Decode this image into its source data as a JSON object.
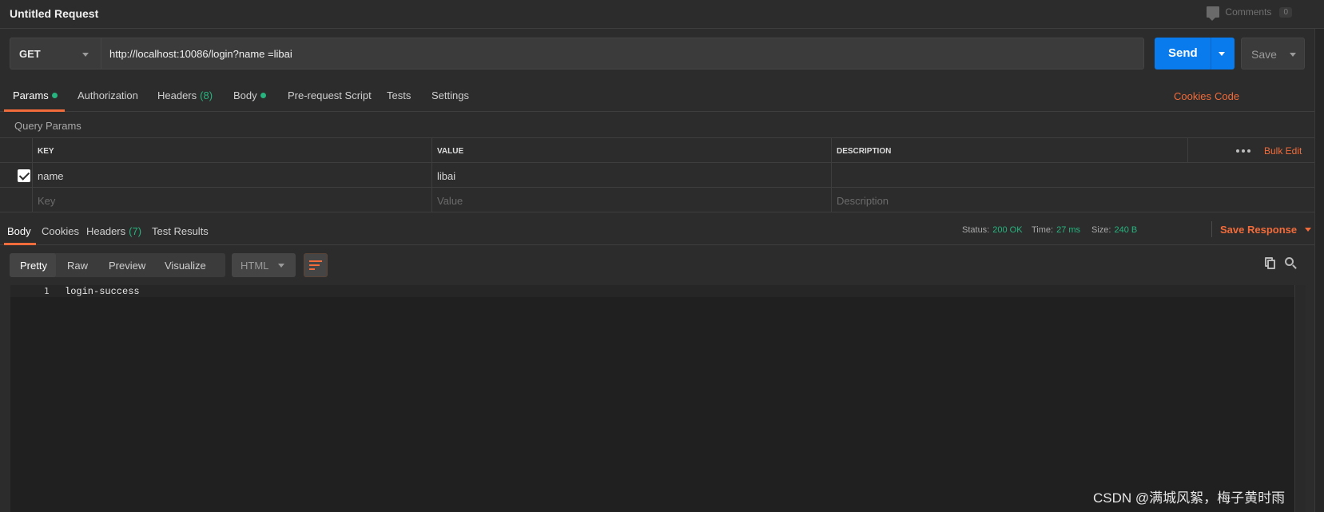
{
  "header": {
    "title": "Untitled Request",
    "comments_label": "Comments",
    "comments_count": "0"
  },
  "request": {
    "method": "GET",
    "url": "http://localhost:10086/login?name =libai",
    "send_label": "Send",
    "save_label": "Save"
  },
  "request_tabs": [
    {
      "label": "Params",
      "has_dot": true,
      "active": true
    },
    {
      "label": "Authorization"
    },
    {
      "label": "Headers",
      "count": "(8)"
    },
    {
      "label": "Body",
      "has_dot": true
    },
    {
      "label": "Pre-request Script"
    },
    {
      "label": "Tests"
    },
    {
      "label": "Settings"
    }
  ],
  "request_links": {
    "cookies": "Cookies",
    "code": "Code"
  },
  "query_params": {
    "section_label": "Query Params",
    "headers": {
      "key": "KEY",
      "value": "VALUE",
      "description": "DESCRIPTION"
    },
    "bulk_edit": "Bulk Edit",
    "rows": [
      {
        "checked": true,
        "key": "name",
        "value": "libai",
        "description": ""
      }
    ],
    "placeholders": {
      "key": "Key",
      "value": "Value",
      "description": "Description"
    }
  },
  "response_tabs": [
    {
      "label": "Body",
      "active": true
    },
    {
      "label": "Cookies"
    },
    {
      "label": "Headers",
      "count": "(7)"
    },
    {
      "label": "Test Results"
    }
  ],
  "response_status": {
    "status_label": "Status:",
    "status_value": "200 OK",
    "time_label": "Time:",
    "time_value": "27 ms",
    "size_label": "Size:",
    "size_value": "240 B",
    "save_response": "Save Response"
  },
  "view_modes": [
    "Pretty",
    "Raw",
    "Preview",
    "Visualize"
  ],
  "format": "HTML",
  "response_body": [
    {
      "line": "1",
      "text": "login-success"
    }
  ],
  "watermark": "CSDN @满城风絮，梅子黄时雨",
  "colors": {
    "accent": "#f26b3a",
    "send": "#097bed",
    "success": "#26b47f",
    "background": "#2c2c2c"
  },
  "icons": [
    "comments-icon",
    "chevron-down-icon",
    "checkbox-checked-icon",
    "more-horizontal-icon",
    "wrap-lines-icon",
    "copy-icon",
    "search-icon"
  ]
}
